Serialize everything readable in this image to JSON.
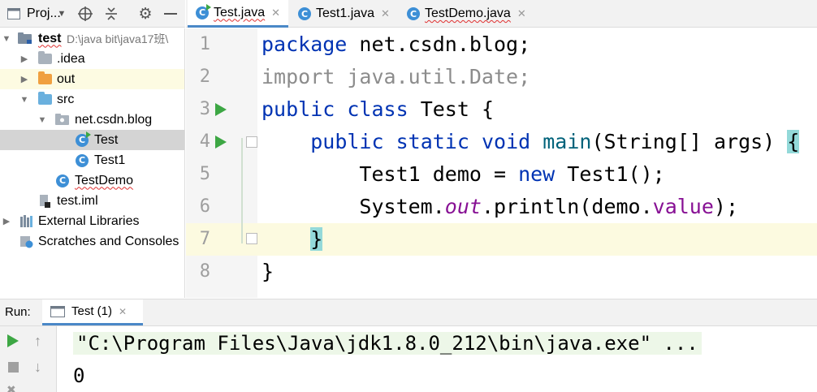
{
  "project_panel": {
    "title": "Proj...",
    "tree": [
      {
        "label": "test",
        "path": "D:\\java bit\\java17班\\",
        "type": "module",
        "bold": true
      },
      {
        "label": ".idea",
        "type": "folder"
      },
      {
        "label": "out",
        "type": "folder-orange"
      },
      {
        "label": "src",
        "type": "folder-blue"
      },
      {
        "label": "net.csdn.blog",
        "type": "package"
      },
      {
        "label": "Test",
        "type": "class-run"
      },
      {
        "label": "Test1",
        "type": "class"
      },
      {
        "label": "TestDemo",
        "type": "class"
      },
      {
        "label": "test.iml",
        "type": "file"
      },
      {
        "label": "External Libraries",
        "type": "library"
      },
      {
        "label": "Scratches and Consoles",
        "type": "scratches"
      }
    ]
  },
  "tabs": [
    {
      "label": "Test.java",
      "active": true
    },
    {
      "label": "Test1.java",
      "active": false
    },
    {
      "label": "TestDemo.java",
      "active": false
    }
  ],
  "editor": {
    "line_numbers": [
      "1",
      "2",
      "3",
      "4",
      "5",
      "6",
      "7",
      "8"
    ],
    "lines": [
      {
        "t1": "package",
        "t2": " net.csdn.blog;"
      },
      {
        "t1": "import java.util.Date;"
      },
      {
        "t1": "public",
        "t2": " ",
        "t3": "class",
        "t4": " Test {"
      },
      {
        "t1": "    ",
        "t2": "public",
        "t3": " ",
        "t4": "static",
        "t5": " ",
        "t6": "void",
        "t7": " ",
        "t8": "main",
        "t9": "(String[] args) ",
        "t10": "{"
      },
      {
        "t1": "        Test1 demo = ",
        "t2": "new",
        "t3": " Test1();"
      },
      {
        "t1": "        System.",
        "t2": "out",
        "t3": ".println(demo.",
        "t4": "value",
        "t5": ");"
      },
      {
        "t1": "    ",
        "t2": "}"
      },
      {
        "t1": "}"
      }
    ]
  },
  "run_panel": {
    "label": "Run:",
    "tab_label": "Test (1)",
    "console": {
      "command": "\"C:\\Program Files\\Java\\jdk1.8.0_212\\bin\\java.exe\" ...",
      "output": "0"
    }
  },
  "colors": {
    "keyword": "#0033b3",
    "field": "#871094",
    "method": "#00627a",
    "unused_import": "#8c8c8c",
    "brace_highlight": "#93d9d9",
    "run_green": "#3da744",
    "tab_underline": "#4a88c7"
  },
  "icons": [
    "project-icon",
    "chevron-down-icon",
    "crosshair-icon",
    "collapse-all-icon",
    "gear-icon",
    "minimize-icon",
    "class-icon",
    "close-icon",
    "run-icon",
    "stop-icon",
    "arrow-up-icon",
    "arrow-down-icon",
    "wrench-icon"
  ]
}
